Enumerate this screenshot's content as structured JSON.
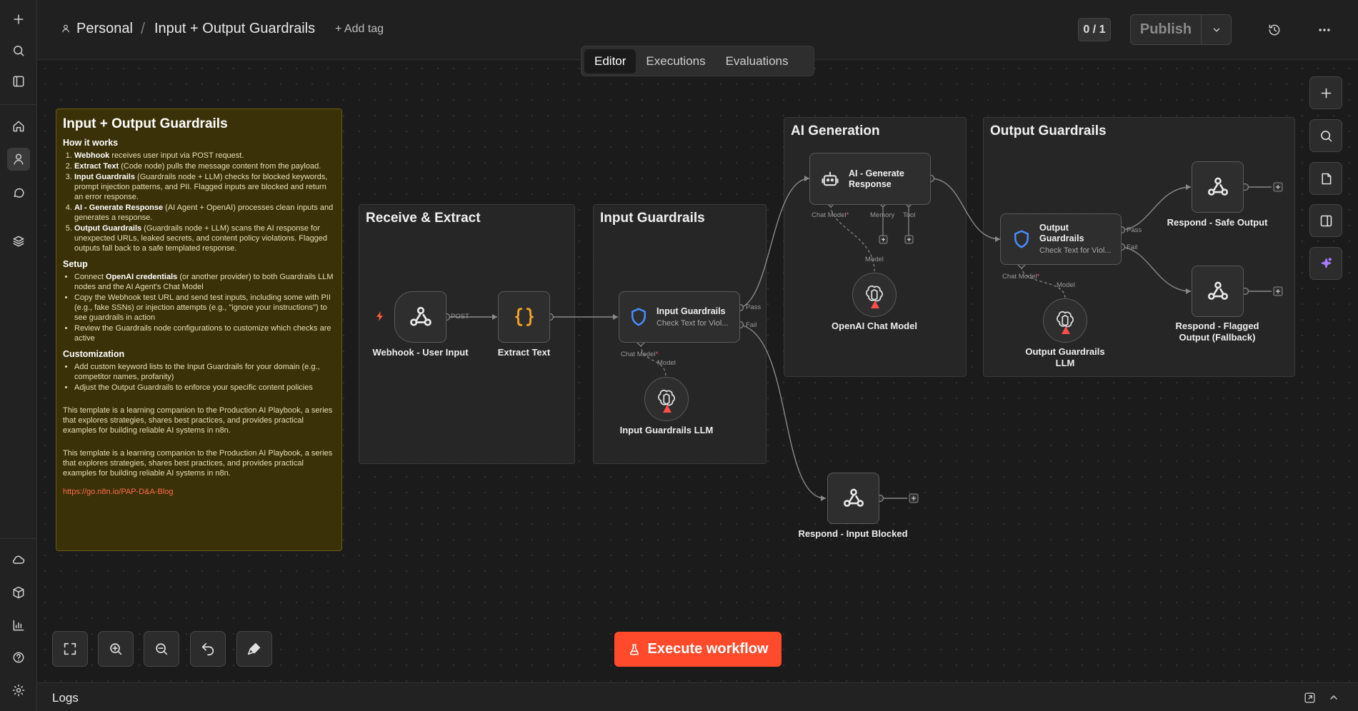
{
  "header": {
    "project": "Personal",
    "workflow_name": "Input + Output Guardrails",
    "add_tag": "+ Add tag",
    "counter": "0 / 1",
    "publish_label": "Publish"
  },
  "tabs": [
    {
      "label": "Editor",
      "active": true
    },
    {
      "label": "Executions",
      "active": false
    },
    {
      "label": "Evaluations",
      "active": false
    }
  ],
  "note": {
    "title": "Input + Output Guardrails",
    "how_heading": "How it works",
    "steps": [
      {
        "bold": "Webhook",
        "text": " receives user input via POST request."
      },
      {
        "bold": "Extract Text",
        "text": " (Code node) pulls the message content from the payload."
      },
      {
        "bold": "Input Guardrails",
        "text": " (Guardrails node + LLM) checks for blocked keywords, prompt injection patterns, and PII. Flagged inputs are blocked and return an error response."
      },
      {
        "bold": "AI - Generate Response",
        "text": " (AI Agent + OpenAI) processes clean inputs and generates a response."
      },
      {
        "bold": "Output Guardrails",
        "text": " (Guardrails node + LLM) scans the AI response for unexpected URLs, leaked secrets, and content policy violations. Flagged outputs fall back to a safe templated response."
      }
    ],
    "setup_heading": "Setup",
    "setup_items": [
      {
        "pre": "Connect ",
        "bold": "OpenAI credentials",
        "text": " (or another provider) to both Guardrails LLM nodes and the AI Agent's Chat Model"
      },
      {
        "pre": "",
        "bold": "",
        "text": "Copy the Webhook test URL and send test inputs, including some with PII (e.g., fake SSNs) or injection attempts (e.g., \"ignore your instructions\") to see guardrails in action"
      },
      {
        "pre": "",
        "bold": "",
        "text": "Review the Guardrails node configurations to customize which checks are active"
      }
    ],
    "custom_heading": "Customization",
    "custom_items": [
      "Add custom keyword lists to the Input Guardrails for your domain (e.g., competitor names, profanity)",
      "Adjust the Output Guardrails to enforce your specific content policies"
    ],
    "para1": "This template is a learning companion to the Production AI Playbook, a series that explores strategies, shares best practices, and provides practical examples for building reliable AI systems in n8n.",
    "para2": "This template is a learning companion to the Production AI Playbook, a series that explores strategies, shares best practices, and provides practical examples for building reliable AI systems in n8n.",
    "link": "https://go.n8n.io/PAP-D&A-Blog"
  },
  "groups": {
    "receive": "Receive & Extract",
    "input": "Input Guardrails",
    "ai": "AI Generation",
    "output": "Output Guardrails"
  },
  "nodes": {
    "webhook": "Webhook - User Input",
    "extract": "Extract Text",
    "input_guard_title": "Input Guardrails",
    "input_guard_sub": "Check Text for Viol...",
    "input_llm": "Input Guardrails LLM",
    "ai_title": "AI - Generate Response",
    "openai": "OpenAI Chat Model",
    "output_guard_title": "Output Guardrails",
    "output_guard_sub": "Check Text for Viol...",
    "output_llm": "Output Guardrails LLM",
    "safe": "Respond - Safe Output",
    "flagged": "Respond - Flagged Output (Fallback)",
    "blocked": "Respond - Input Blocked"
  },
  "ports": {
    "post": "POST",
    "pass": "Pass",
    "fail": "Fail",
    "chat_model": "Chat Model",
    "model": "Model",
    "memory": "Memory",
    "tool": "Tool",
    "required": "*"
  },
  "execute_label": "Execute workflow",
  "logs_title": "Logs",
  "colors": {
    "accent": "#ff4b2b",
    "note_bg": "#3b3108",
    "guard_blue": "#4a8cff",
    "code_orange": "#f5a623",
    "warning_red": "#ff4d4d",
    "magic_purple": "#a97bff"
  }
}
